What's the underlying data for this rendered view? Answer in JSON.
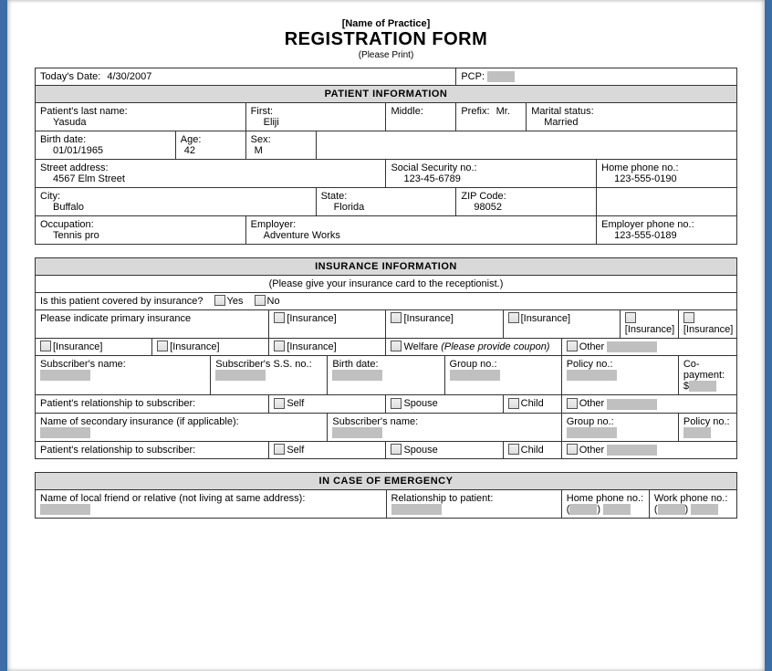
{
  "header": {
    "practice": "[Name of Practice]",
    "title": "REGISTRATION FORM",
    "subtitle": "(Please Print)"
  },
  "top": {
    "today_label": "Today's Date:",
    "today_value": "4/30/2007",
    "pcp_label": "PCP:"
  },
  "patient": {
    "section": "PATIENT INFORMATION",
    "last_label": "Patient's last name:",
    "last_value": "Yasuda",
    "first_label": "First:",
    "first_value": "Eliji",
    "middle_label": "Middle:",
    "prefix_label": "Prefix:",
    "prefix_value": "Mr.",
    "marital_label": "Marital status:",
    "marital_value": "Married",
    "birth_label": "Birth date:",
    "birth_value": "01/01/1965",
    "age_label": "Age:",
    "age_value": "42",
    "sex_label": "Sex:",
    "sex_value": "M",
    "street_label": "Street address:",
    "street_value": "4567 Elm Street",
    "ssn_label": "Social Security no.:",
    "ssn_value": "123-45-6789",
    "home_phone_label": "Home phone no.:",
    "home_phone_value": "123-555-0190",
    "city_label": "City:",
    "city_value": "Buffalo",
    "state_label": "State:",
    "state_value": "Florida",
    "zip_label": "ZIP Code:",
    "zip_value": "98052",
    "occupation_label": "Occupation:",
    "occupation_value": "Tennis pro",
    "employer_label": "Employer:",
    "employer_value": "Adventure Works",
    "employer_phone_label": "Employer phone no.:",
    "employer_phone_value": "123-555-0189"
  },
  "insurance": {
    "section": "INSURANCE INFORMATION",
    "note": "(Please give your insurance card to the receptionist.)",
    "covered_q": "Is this patient covered by insurance?",
    "yes": "Yes",
    "no": "No",
    "primary_label": "Please indicate primary insurance",
    "ins_placeholder": "[Insurance]",
    "welfare_label": "Welfare",
    "welfare_note": "(Please provide coupon)",
    "other_label": "Other",
    "sub_name_label": "Subscriber's name:",
    "sub_ssn_label": "Subscriber's S.S. no.:",
    "sub_birth_label": "Birth date:",
    "group_label": "Group no.:",
    "policy_label": "Policy no.:",
    "copay_label": "Co-payment:",
    "copay_prefix": "$",
    "rel_label": "Patient's relationship to subscriber:",
    "self": "Self",
    "spouse": "Spouse",
    "child": "Child",
    "secondary_label": "Name of secondary insurance (if applicable):"
  },
  "emergency": {
    "section": "IN CASE OF EMERGENCY",
    "friend_label": "Name of local friend or relative (not living at same address):",
    "rel_label": "Relationship to patient:",
    "home_label": "Home phone no.:",
    "work_label": "Work phone no.:",
    "phone_open": "(",
    "phone_close": ")"
  }
}
